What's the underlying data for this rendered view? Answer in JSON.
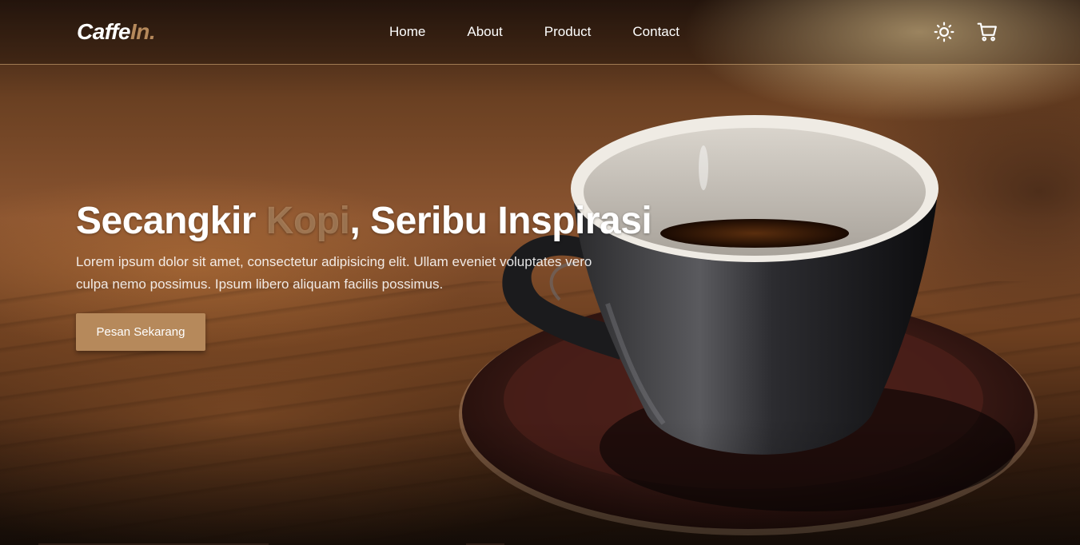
{
  "brand": {
    "name_main": "Caffe",
    "name_accent": "In."
  },
  "nav": {
    "links": [
      {
        "label": "Home"
      },
      {
        "label": "About"
      },
      {
        "label": "Product"
      },
      {
        "label": "Contact"
      }
    ],
    "icons": [
      "sun-icon",
      "shopping-cart-icon"
    ]
  },
  "hero": {
    "title_start": "Secangkir ",
    "title_highlight": "Kopi",
    "title_end": ", Seribu Inspirasi",
    "description": "Lorem ipsum dolor sit amet, consectetur adipisicing elit. Ullam eveniet voluptates vero culpa nemo possimus. Ipsum libero aliquam facilis possimus.",
    "cta_label": "Pesan Sekarang"
  },
  "colors": {
    "accent": "#b6895b",
    "text": "#ffffff"
  }
}
